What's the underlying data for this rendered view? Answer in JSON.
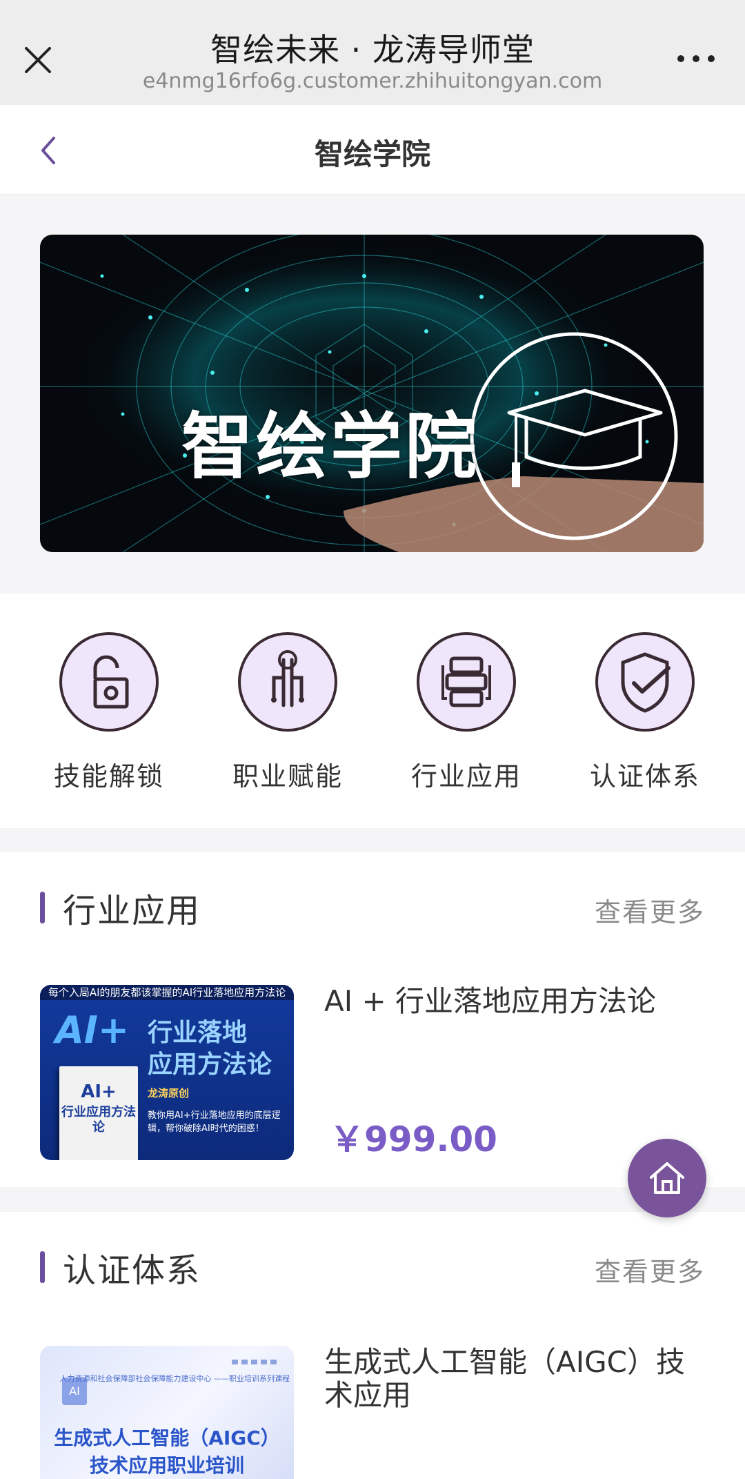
{
  "browser": {
    "title": "智绘未来 · 龙涛导师堂",
    "url": "e4nmg16rfo6g.customer.zhihuitongyan.com"
  },
  "nav": {
    "title": "智绘学院"
  },
  "banner": {
    "text": "智绘学院"
  },
  "categories": [
    {
      "label": "技能解锁",
      "icon": "unlock-icon"
    },
    {
      "label": "职业赋能",
      "icon": "finger-circuit-icon"
    },
    {
      "label": "行业应用",
      "icon": "stack-icon"
    },
    {
      "label": "认证体系",
      "icon": "shield-check-icon"
    }
  ],
  "sections": [
    {
      "title": "行业应用",
      "more": "查看更多",
      "item": {
        "title": "AI + 行业落地应用方法论",
        "price": "￥999.00",
        "cover": {
          "top": "每个入局AI的朋友都该掌握的AI行业落地应用方法论",
          "big": "AI+",
          "line1": "行业落地",
          "line2": "应用方法论",
          "book_title": "AI+",
          "book_sub": "行业应用方法论",
          "author": "龙涛原创",
          "desc": "教你用AI+行业落地应用的底层逻辑，帮你破除AI时代的困惑！"
        }
      }
    },
    {
      "title": "认证体系",
      "more": "查看更多",
      "item": {
        "title": "生成式人工智能（AIGC）技术应用",
        "cover": {
          "ai": "AI",
          "org": "人力资源和社会保障部社会保障能力建设中心 ——职业培训系列课程",
          "line1": "生成式人工智能（AIGC）",
          "line2": "技术应用职业培训"
        }
      }
    }
  ],
  "colors": {
    "accent": "#7a5cc7",
    "section_bar": "#6c4f9c",
    "home_button": "#7a549b"
  }
}
